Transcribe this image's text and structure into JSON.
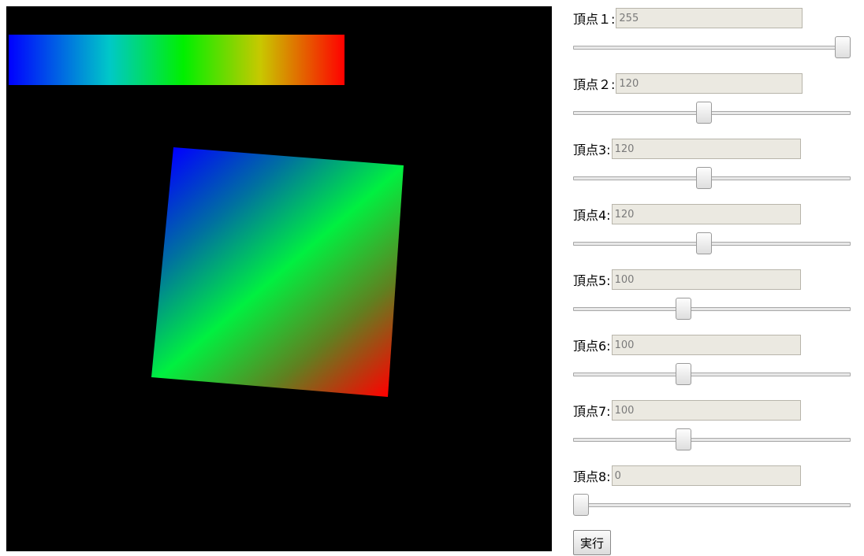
{
  "vertices": [
    {
      "label": "頂点１:",
      "value": "255",
      "slider_fraction": 1.0
    },
    {
      "label": "頂点２:",
      "value": "120",
      "slider_fraction": 0.471
    },
    {
      "label": "頂点3:",
      "value": "120",
      "slider_fraction": 0.471
    },
    {
      "label": "頂点4:",
      "value": "120",
      "slider_fraction": 0.471
    },
    {
      "label": "頂点5:",
      "value": "100",
      "slider_fraction": 0.392
    },
    {
      "label": "頂点6:",
      "value": "100",
      "slider_fraction": 0.392
    },
    {
      "label": "頂点7:",
      "value": "100",
      "slider_fraction": 0.392
    },
    {
      "label": "頂点8:",
      "value": "0",
      "slider_fraction": 0.0
    }
  ],
  "run_button": {
    "label": "実行"
  },
  "colors": {
    "canvas_bg": "#000000",
    "gradient_start": "#0000ff",
    "gradient_mid": "#00f000",
    "gradient_end": "#ff0000",
    "input_bg": "#ebe9e1"
  }
}
